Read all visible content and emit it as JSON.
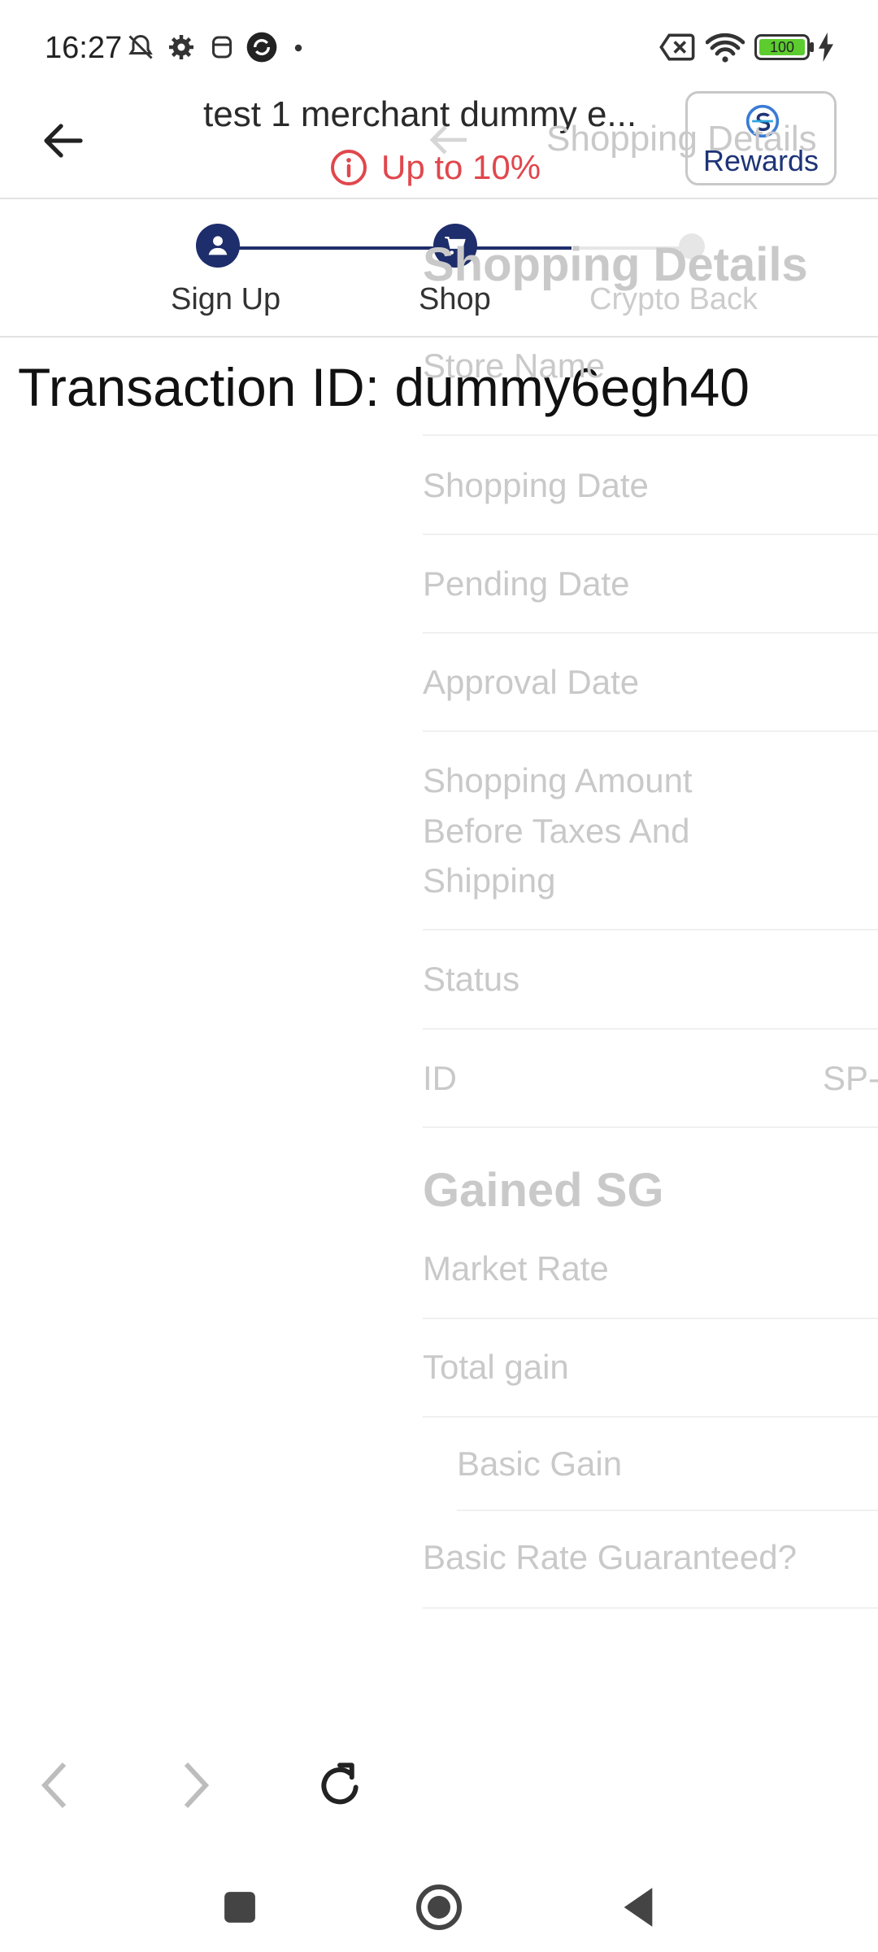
{
  "status_bar": {
    "time": "16:27",
    "battery": "100"
  },
  "header": {
    "title": "test 1 merchant dummy e...",
    "rate": "Up to 10%",
    "rewards_label": "Rewards"
  },
  "stepper": {
    "steps": [
      {
        "label": "Sign Up",
        "icon": "person-icon"
      },
      {
        "label": "Shop",
        "icon": "cart-icon"
      },
      {
        "label": "Crypto Back",
        "icon": "dot-icon"
      }
    ]
  },
  "transaction": {
    "text": "Transaction ID: dummy6egh40"
  },
  "ghost": {
    "back_title": "Shopping Details",
    "section_title": "Shopping Details",
    "rows": [
      "Store Name",
      "Shopping Date",
      "Pending Date",
      "Approval Date",
      "Shopping Amount",
      "Before Taxes And",
      "Shipping",
      "Status",
      "ID"
    ],
    "id_value": "SP-",
    "gained_title": "Gained SG",
    "gained_rows": [
      "Market Rate",
      "Total gain",
      "Basic Gain",
      "Basic Rate Guaranteed?"
    ]
  },
  "colors": {
    "accent": "#1e2d6b",
    "rate_red": "#e0474c",
    "rewards_blue": "#1e3477"
  }
}
